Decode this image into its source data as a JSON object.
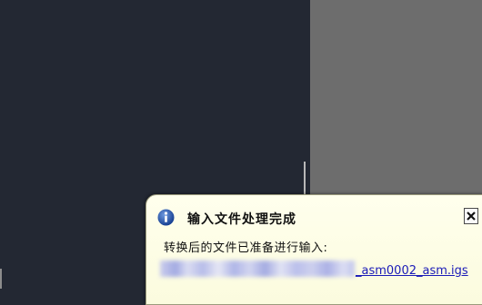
{
  "colors": {
    "viewport_bg": "#232833",
    "side_panel_bg": "#6d6d6d",
    "toast_bg": "#fdfde6",
    "link": "#1a1ab8",
    "info_icon": "#1f4fa8"
  },
  "notification": {
    "icon": "info-icon",
    "title": "输入文件处理完成",
    "message": "转换后的文件已准备进行输入:",
    "file_link": "_asm0002_asm.igs",
    "close_icon": "close-icon"
  }
}
